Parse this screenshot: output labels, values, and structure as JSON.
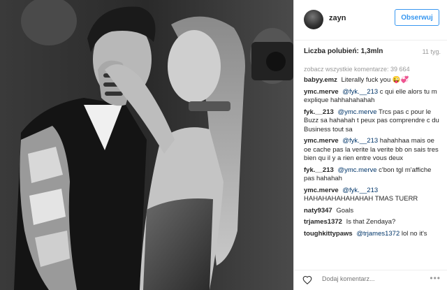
{
  "header": {
    "username": "zayn",
    "follow_label": "Obserwuj"
  },
  "stats": {
    "likes": "Liczba polubień: 1,3mln",
    "time": "11 tyg."
  },
  "view_all": "zobacz wszystkie komentarze: 39 664",
  "comments": [
    {
      "author": "babyy.emz",
      "mention": "",
      "text": "Literally fuck you 😜💞"
    },
    {
      "author": "ymc.merve",
      "mention": "@fyk.__213",
      "text": "c qui elle alors tu m explique hahhahahahah"
    },
    {
      "author": "fyk.__213",
      "mention": "@ymc.merve",
      "text": "Trcs pas c pour le Buzz sa hahahah t peux pas comprendre c du Business tout sa"
    },
    {
      "author": "ymc.merve",
      "mention": "@fyk.__213",
      "text": "hahahhaa mais oe oe cache pas la verite la verite bb on sais tres bien qu il y a rien entre vous deux"
    },
    {
      "author": "fyk.__213",
      "mention": "@ymc.merve",
      "text": "c'bon tgl m'affiche pas hahahah"
    },
    {
      "author": "ymc.merve",
      "mention": "@fyk.__213",
      "text": "HAHAHAHAHAHAHAH TMAS TUERR"
    },
    {
      "author": "naty9347",
      "mention": "",
      "text": "Goals"
    },
    {
      "author": "trjames1372",
      "mention": "",
      "text": "Is that Zendaya?"
    },
    {
      "author": "toughkittypaws",
      "mention": "@trjames1372",
      "text": "lol no it's"
    }
  ],
  "add_comment": {
    "placeholder": "Dodaj komentarz...",
    "more_label": "•••"
  },
  "icons": {
    "heart": "heart-outline-icon",
    "more": "more-options-icon"
  }
}
